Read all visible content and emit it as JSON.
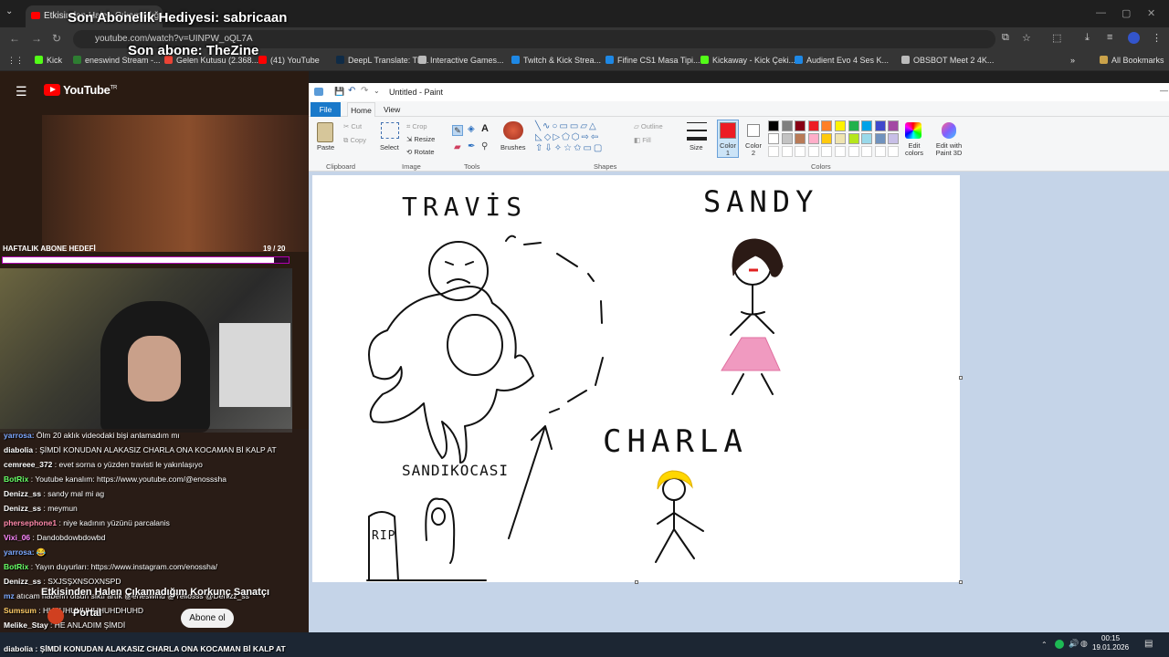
{
  "browser": {
    "tab_title": "Etkisinden Halen Çıkamadığım",
    "url": "youtube.com/watch?v=UINPW_oQL7A",
    "bookmarks": [
      {
        "label": "Kick",
        "color": "#53fc18"
      },
      {
        "label": "eneswind Stream -...",
        "color": "#2e7d32"
      },
      {
        "label": "Gelen Kutusu (2.368...",
        "color": "#ea4335"
      },
      {
        "label": "(41) YouTube",
        "color": "#ff0000"
      },
      {
        "label": "DeepL Translate: Th...",
        "color": "#0f2b46"
      },
      {
        "label": "Interactive Games...",
        "color": "#bbbbbb"
      },
      {
        "label": "Twitch & Kick Strea...",
        "color": "#1e88e5"
      },
      {
        "label": "Fifine CS1 Masa Tipi...",
        "color": "#1e88e5"
      },
      {
        "label": "Kickaway - Kick Çeki...",
        "color": "#53fc18"
      },
      {
        "label": "Audient Evo 4 Ses K...",
        "color": "#1e88e5"
      },
      {
        "label": "OBSBOT Meet 2 4K...",
        "color": "#bbbbbb"
      }
    ],
    "all_bookmarks": "All Bookmarks"
  },
  "overlay": {
    "last_gift": "Son Abonelik Hediyesi: sabricaan",
    "last_sub": "Son abone: TheZine",
    "weekly_goal_label": "HAFTALIK ABONE HEDEFİ",
    "weekly_goal_count": "19 / 20",
    "weekly_goal_progress": 0.95
  },
  "youtube": {
    "logo_text": "YouTube",
    "logo_sup": "TR",
    "video_title": "Etkisinden Halen Çıkamadığım Korkunç Sanatçı",
    "channel_name": "Portal",
    "subscribe_label": "Abone ol"
  },
  "chat": [
    {
      "user": "yarrosa:",
      "text": "Ölm 20 aklık videodaki bişi anlamadım mı",
      "color": "#7aa8ff"
    },
    {
      "user": "diabolia",
      "text": ": ŞİMDİ KONUDAN ALAKASIZ CHARLA ONA KOCAMAN Bİ KALP AT",
      "color": "#ffffff"
    },
    {
      "user": "cemreee_372",
      "text": ": evet sorna o yüzden travisti le yakınlaşıyo",
      "color": "#ffffff"
    },
    {
      "user": "BotRix",
      "text": ": Youtube kanalım: https://www.youtube.com/@enosssha",
      "color": "#66ff66"
    },
    {
      "user": "Denizz_ss",
      "text": ": sandy mal mi ag",
      "color": "#ffffff"
    },
    {
      "user": "Denizz_ss",
      "text": ": meymun",
      "color": "#ffffff"
    },
    {
      "user": "phersephone1",
      "text": ": niye kadının yüzünü parcalanis",
      "color": "#ff88aa"
    },
    {
      "user": "Vixi_06",
      "text": ": Dandobdowbdowbd",
      "color": "#ff88ff"
    },
    {
      "user": "yarrosa:",
      "text": "😂",
      "color": "#7aa8ff"
    },
    {
      "user": "BotRix",
      "text": ": Yayın duyurları: https://www.instagram.com/enossha/",
      "color": "#66ff66"
    },
    {
      "user": "Denizz_ss",
      "text": ": SXJSŞXNSOXNSPD",
      "color": "#ffffff"
    },
    {
      "user": "mz",
      "text": "atıcam haberin olsun sıktı artık @eneswind @Yellosss @Denizz_ss",
      "color": "#7aa8ff"
    },
    {
      "user": "Sumsum",
      "text": ": HUSUHUHUHUHUHDHUHD",
      "color": "#ffcc66"
    },
    {
      "user": "Melike_Stay",
      "text": ": HE ANLADIM ŞİMDİ",
      "color": "#ffffff"
    }
  ],
  "ticker": "diabolia : ŞİMDİ KONUDAN ALAKASIZ CHARLA ONA KOCAMAN Bİ KALP AT",
  "paint": {
    "window_title": "Untitled - Paint",
    "tabs": [
      "File",
      "Home",
      "View"
    ],
    "clipboard": {
      "paste": "Paste",
      "cut": "Cut",
      "copy": "Copy",
      "group": "Clipboard"
    },
    "image": {
      "select": "Select",
      "crop": "Crop",
      "resize": "Resize",
      "rotate": "Rotate",
      "group": "Image"
    },
    "tools_group": "Tools",
    "brushes": "Brushes",
    "shapes": {
      "outline": "Outline",
      "fill": "Fill",
      "group": "Shapes"
    },
    "size": "Size",
    "color1": "Color 1",
    "color2": "Color 2",
    "colors_group": "Colors",
    "edit_colors": "Edit colors",
    "edit_3d": "Edit with Paint 3D",
    "palette": [
      "#000000",
      "#7f7f7f",
      "#880015",
      "#ed1c24",
      "#ff7f27",
      "#fff200",
      "#22b14c",
      "#00a2e8",
      "#3f48cc",
      "#a349a4",
      "#ffffff",
      "#c3c3c3",
      "#b97a57",
      "#ffaec9",
      "#ffc90e",
      "#efe4b0",
      "#b5e61d",
      "#99d9ea",
      "#7092be",
      "#c8bfe7"
    ],
    "canvas_labels": {
      "travis": "TRAVİS",
      "sandy": "SANDY",
      "charla": "CHARLA",
      "husband": "SANDIKOCASI",
      "rip": "RIP"
    }
  },
  "taskbar": {
    "time": "00:15",
    "date": "19.01.2026"
  }
}
